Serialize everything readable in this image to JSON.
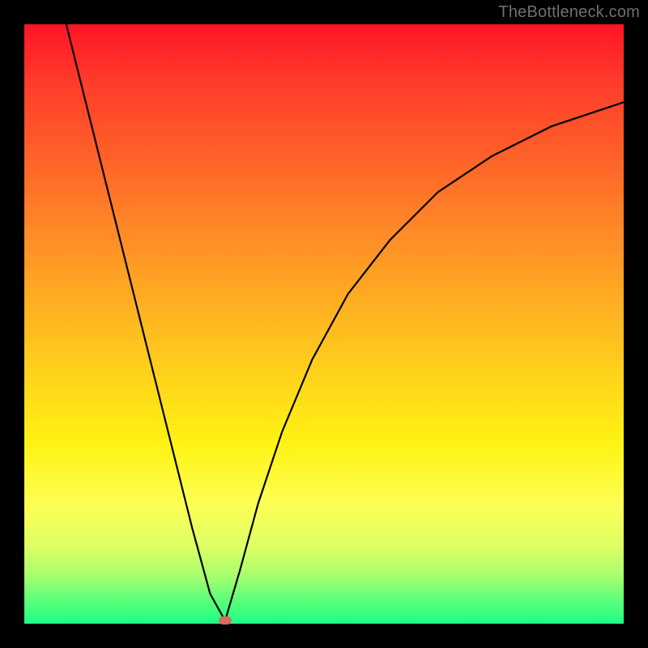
{
  "watermark": "TheBottleneck.com",
  "colors": {
    "frame_border": "#000000",
    "curve_stroke": "#000000",
    "marker_fill": "#d96b5e",
    "gradient_top": "#ff1525",
    "gradient_bottom": "#1cfd84"
  },
  "chart_data": {
    "type": "line",
    "title": "",
    "xlabel": "",
    "ylabel": "",
    "xlim": [
      0,
      100
    ],
    "ylim": [
      0,
      100
    ],
    "grid": false,
    "legend": false,
    "annotation": "Two curves meeting at a single minimum near the x-axis; left branch descends steeply from top-left, right branch rises concave toward top-right. A small marker sits at the minimum. Background is a vertical red→green gradient.",
    "series": [
      {
        "name": "left-branch",
        "x": [
          7,
          10,
          13,
          16,
          19,
          22,
          25,
          28,
          31,
          33.5
        ],
        "y": [
          100,
          88,
          76,
          64,
          52,
          40,
          28,
          16,
          5,
          0.5
        ]
      },
      {
        "name": "right-branch",
        "x": [
          33.5,
          36,
          39,
          43,
          48,
          54,
          61,
          69,
          78,
          88,
          100
        ],
        "y": [
          0.5,
          9,
          20,
          32,
          44,
          55,
          64,
          72,
          78,
          83,
          87
        ]
      }
    ],
    "marker": {
      "x": 33.5,
      "y": 0.5
    }
  }
}
